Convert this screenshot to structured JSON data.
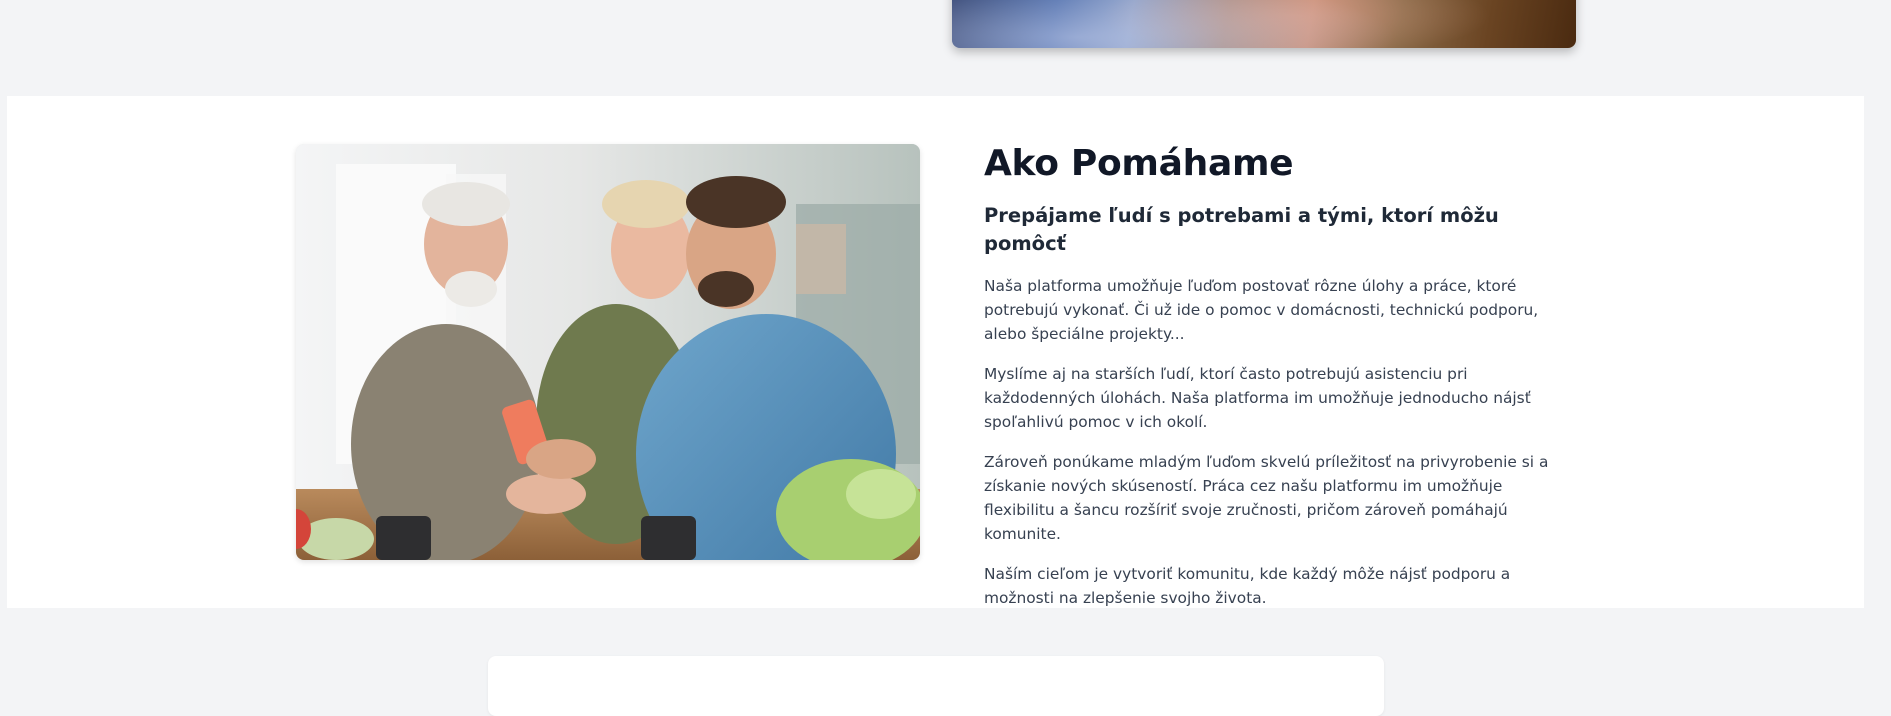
{
  "section": {
    "title": "Ako Pomáhame",
    "subtitle": "Prepájame ľudí s potrebami a tými, ktorí môžu pomôcť",
    "paragraphs": [
      "Naša platforma umožňuje ľuďom postovať rôzne úlohy a práce, ktoré potrebujú vykonať. Či už ide o pomoc v domácnosti, technickú podporu, alebo špeciálne projekty...",
      "Myslíme aj na starších ľudí, ktorí často potrebujú asistenciu pri každodenných úlohách. Naša platforma im umožňuje jednoducho nájsť spoľahlivú pomoc v ich okolí.",
      "Zároveň ponúkame mladým ľuďom skvelú príležitosť na privyrobenie si a získanie nových skúseností. Práca cez našu platformu im umožňuje flexibilitu a šancu rozšíriť svoje zručnosti, pričom zároveň pomáhajú komunite.",
      "Naším cieľom je vytvoriť komunitu, kde každý môže nájsť podporu a možnosti na zlepšenie svojho života."
    ]
  },
  "colors": {
    "page_background": "#f3f4f6",
    "section_background": "#ffffff",
    "heading": "#111827",
    "body_text": "#374151"
  }
}
